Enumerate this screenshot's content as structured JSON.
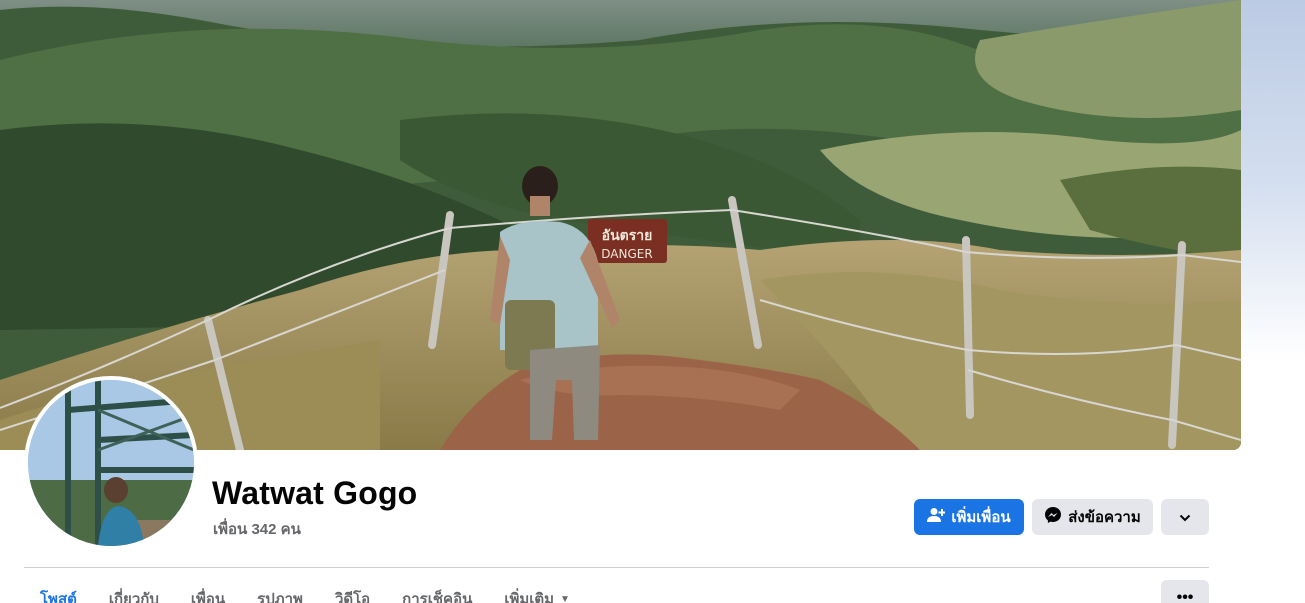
{
  "profile": {
    "name": "Watwat Gogo",
    "friends_count": "เพื่อน 342 คน"
  },
  "cover": {
    "sign_text_thai": "อันตราย",
    "sign_text_en": "DANGER"
  },
  "actions": {
    "add_friend_label": "เพิ่มเพื่อน",
    "message_label": "ส่งข้อความ"
  },
  "tabs": [
    {
      "label": "โพสต์",
      "active": true
    },
    {
      "label": "เกี่ยวกับ",
      "active": false
    },
    {
      "label": "เพื่อน",
      "active": false
    },
    {
      "label": "รูปภาพ",
      "active": false
    },
    {
      "label": "วิดีโอ",
      "active": false
    },
    {
      "label": "การเช็คอิน",
      "active": false
    },
    {
      "label": "เพิ่มเติม",
      "active": false
    }
  ],
  "colors": {
    "accent": "#1b74e4",
    "secondary_button": "#e4e6eb",
    "muted_text": "#65676b"
  },
  "icons": {
    "add_friend": "person-plus-icon",
    "message": "messenger-icon",
    "more": "chevron-down-icon",
    "overflow": "ellipsis-icon"
  }
}
